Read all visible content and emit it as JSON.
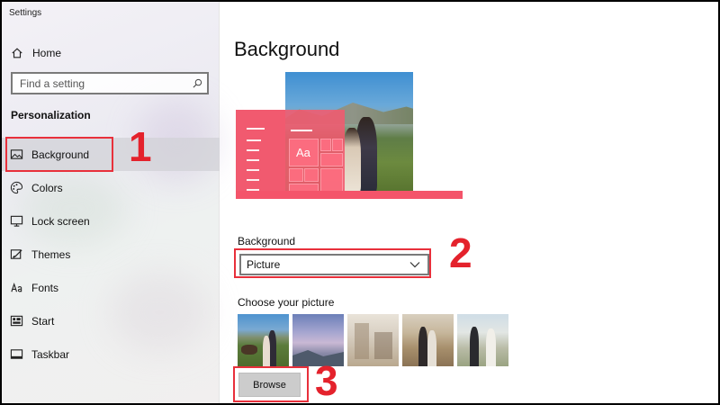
{
  "window": {
    "title": "Settings"
  },
  "sidebar": {
    "home_label": "Home",
    "search_placeholder": "Find a setting",
    "section_title": "Personalization",
    "items": [
      {
        "label": "Background",
        "icon": "image-icon",
        "selected": true
      },
      {
        "label": "Colors",
        "icon": "palette-icon",
        "selected": false
      },
      {
        "label": "Lock screen",
        "icon": "lock-screen-icon",
        "selected": false
      },
      {
        "label": "Themes",
        "icon": "themes-icon",
        "selected": false
      },
      {
        "label": "Fonts",
        "icon": "fonts-icon",
        "selected": false
      },
      {
        "label": "Start",
        "icon": "start-icon",
        "selected": false
      },
      {
        "label": "Taskbar",
        "icon": "taskbar-icon",
        "selected": false
      }
    ]
  },
  "main": {
    "page_title": "Background",
    "preview_tile_text": "Aa",
    "background_label": "Background",
    "background_selected": "Picture",
    "choose_picture_label": "Choose your picture",
    "thumbnails": [
      "couple-horse-field",
      "purple-sky-hills",
      "indoor-room",
      "couple-autumn-street",
      "couple-outdoor-day"
    ],
    "browse_label": "Browse"
  },
  "annotations": {
    "step1": "1",
    "step2": "2",
    "step3": "3"
  },
  "colors": {
    "highlight": "#e8303b",
    "accent_pink": "#f15a6f",
    "selected_bg": "#d2d2d7"
  }
}
